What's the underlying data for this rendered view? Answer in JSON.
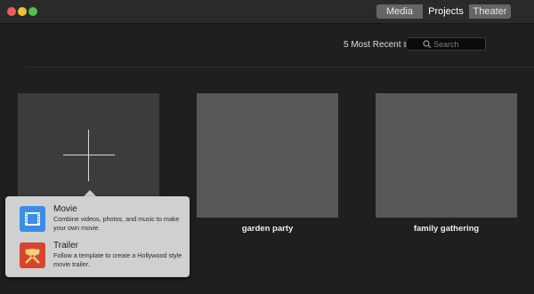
{
  "titlebar": {
    "tabs": [
      {
        "label": "Media"
      },
      {
        "label": "Projects"
      },
      {
        "label": "Theater"
      }
    ],
    "selected_tab": "Projects"
  },
  "toolbar": {
    "sort_label": "5 Most Recent",
    "search_placeholder": "Search"
  },
  "projects": [
    {
      "name": "garden party"
    },
    {
      "name": "family gathering"
    }
  ],
  "new_project_popover": {
    "options": [
      {
        "title": "Movie",
        "description": "Combine videos, photos, and music to make your own movie.",
        "icon": "film-icon"
      },
      {
        "title": "Trailer",
        "description": "Follow a template to create a Hollywood style movie trailer.",
        "icon": "trailer-icon"
      }
    ]
  },
  "colors": {
    "background": "#1f1f1f",
    "tile": "#575757",
    "popover": "#d0d0d0",
    "movie_icon": "#3d8de6",
    "trailer_icon": "#d8452e"
  }
}
